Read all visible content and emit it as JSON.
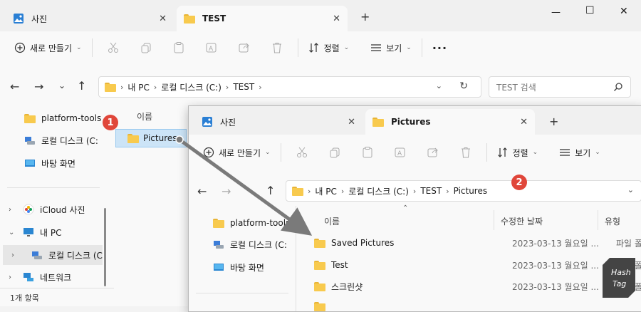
{
  "back_window": {
    "tabs": [
      {
        "label": "사진",
        "icon": "photos-icon"
      },
      {
        "label": "TEST",
        "icon": "folder-icon"
      }
    ],
    "new_tab": "+",
    "window_controls": {
      "minimize": "—",
      "maximize": "☐",
      "close": "✕"
    },
    "toolbar": {
      "new_label": "새로 만들기",
      "sort_label": "정렬",
      "view_label": "보기",
      "more_label": "···"
    },
    "address": {
      "crumbs": [
        "내 PC",
        "로컬 디스크 (C:)",
        "TEST"
      ]
    },
    "search_placeholder": "TEST 검색",
    "sidebar": {
      "items": [
        {
          "label": "platform-tools",
          "icon": "folder-icon"
        },
        {
          "label": "로컬 디스크 (C:",
          "icon": "drive-icon"
        },
        {
          "label": "바탕 화면",
          "icon": "desktop-icon"
        },
        {
          "label": "iCloud 사진",
          "icon": "icloud-photos-icon"
        },
        {
          "label": "내 PC",
          "icon": "pc-icon"
        },
        {
          "label": "로컬 디스크 (C",
          "icon": "drive-icon"
        },
        {
          "label": "네트워크",
          "icon": "network-icon"
        }
      ]
    },
    "column_header_name": "이름",
    "file": {
      "name": "Pictures"
    },
    "status": "1개 항목"
  },
  "front_window": {
    "tabs": [
      {
        "label": "사진",
        "icon": "photos-icon"
      },
      {
        "label": "Pictures",
        "icon": "folder-icon"
      }
    ],
    "new_tab": "+",
    "toolbar": {
      "new_label": "새로 만들기",
      "sort_label": "정렬",
      "view_label": "보기"
    },
    "address": {
      "crumbs": [
        "내 PC",
        "로컬 디스크 (C:)",
        "TEST",
        "Pictures"
      ]
    },
    "sidebar": {
      "items": [
        {
          "label": "platform-tools",
          "icon": "folder-icon"
        },
        {
          "label": "로컬 디스크 (C:",
          "icon": "drive-icon"
        },
        {
          "label": "바탕 화면",
          "icon": "desktop-icon"
        }
      ]
    },
    "columns": {
      "name": "이름",
      "modified": "수정한 날짜",
      "type": "유형"
    },
    "rows": [
      {
        "name": "Saved Pictures",
        "date": "2023-03-13 월요일 ...",
        "type": "파일 폴더"
      },
      {
        "name": "Test",
        "date": "2023-03-13 월요일 ...",
        "type": "파일 폴더"
      },
      {
        "name": "스크린샷",
        "date": "2023-03-13 월요일 ...",
        "type": "파일 폴더"
      }
    ]
  },
  "annotations": {
    "badge1": "1",
    "badge2": "2",
    "accent": "#e0463a",
    "arrow_color": "#7a7a7a"
  },
  "watermark": {
    "line1": "Hash",
    "line2": "Tag"
  }
}
